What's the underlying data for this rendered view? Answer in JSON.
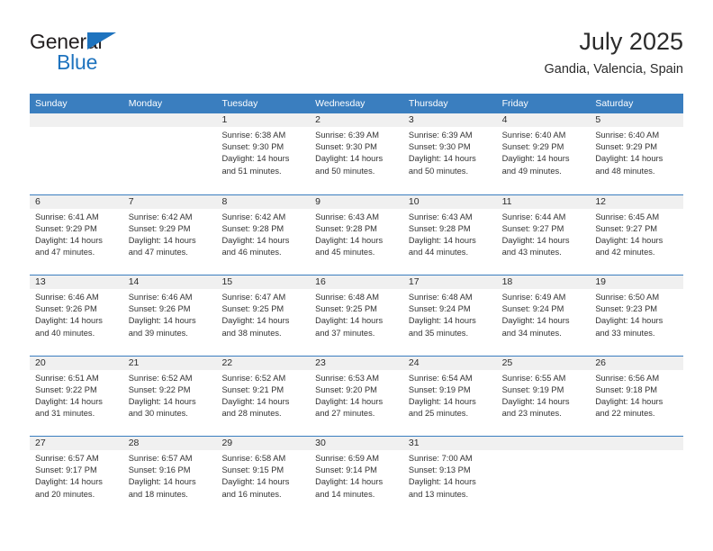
{
  "brand": {
    "line1": "General",
    "line2": "Blue",
    "triangle_color": "#1e73be",
    "text_color": "#231f20"
  },
  "header": {
    "title": "July 2025",
    "subtitle": "Gandia, Valencia, Spain"
  },
  "theme": {
    "header_blue": "#3a7ebf",
    "daynum_band": "#f0f0f0",
    "text": "#333333"
  },
  "weekdays": [
    "Sunday",
    "Monday",
    "Tuesday",
    "Wednesday",
    "Thursday",
    "Friday",
    "Saturday"
  ],
  "weeks": [
    [
      {
        "day": "",
        "sunrise": "",
        "sunset": "",
        "daylight1": "",
        "daylight2": ""
      },
      {
        "day": "",
        "sunrise": "",
        "sunset": "",
        "daylight1": "",
        "daylight2": ""
      },
      {
        "day": "1",
        "sunrise": "Sunrise: 6:38 AM",
        "sunset": "Sunset: 9:30 PM",
        "daylight1": "Daylight: 14 hours",
        "daylight2": "and 51 minutes."
      },
      {
        "day": "2",
        "sunrise": "Sunrise: 6:39 AM",
        "sunset": "Sunset: 9:30 PM",
        "daylight1": "Daylight: 14 hours",
        "daylight2": "and 50 minutes."
      },
      {
        "day": "3",
        "sunrise": "Sunrise: 6:39 AM",
        "sunset": "Sunset: 9:30 PM",
        "daylight1": "Daylight: 14 hours",
        "daylight2": "and 50 minutes."
      },
      {
        "day": "4",
        "sunrise": "Sunrise: 6:40 AM",
        "sunset": "Sunset: 9:29 PM",
        "daylight1": "Daylight: 14 hours",
        "daylight2": "and 49 minutes."
      },
      {
        "day": "5",
        "sunrise": "Sunrise: 6:40 AM",
        "sunset": "Sunset: 9:29 PM",
        "daylight1": "Daylight: 14 hours",
        "daylight2": "and 48 minutes."
      }
    ],
    [
      {
        "day": "6",
        "sunrise": "Sunrise: 6:41 AM",
        "sunset": "Sunset: 9:29 PM",
        "daylight1": "Daylight: 14 hours",
        "daylight2": "and 47 minutes."
      },
      {
        "day": "7",
        "sunrise": "Sunrise: 6:42 AM",
        "sunset": "Sunset: 9:29 PM",
        "daylight1": "Daylight: 14 hours",
        "daylight2": "and 47 minutes."
      },
      {
        "day": "8",
        "sunrise": "Sunrise: 6:42 AM",
        "sunset": "Sunset: 9:28 PM",
        "daylight1": "Daylight: 14 hours",
        "daylight2": "and 46 minutes."
      },
      {
        "day": "9",
        "sunrise": "Sunrise: 6:43 AM",
        "sunset": "Sunset: 9:28 PM",
        "daylight1": "Daylight: 14 hours",
        "daylight2": "and 45 minutes."
      },
      {
        "day": "10",
        "sunrise": "Sunrise: 6:43 AM",
        "sunset": "Sunset: 9:28 PM",
        "daylight1": "Daylight: 14 hours",
        "daylight2": "and 44 minutes."
      },
      {
        "day": "11",
        "sunrise": "Sunrise: 6:44 AM",
        "sunset": "Sunset: 9:27 PM",
        "daylight1": "Daylight: 14 hours",
        "daylight2": "and 43 minutes."
      },
      {
        "day": "12",
        "sunrise": "Sunrise: 6:45 AM",
        "sunset": "Sunset: 9:27 PM",
        "daylight1": "Daylight: 14 hours",
        "daylight2": "and 42 minutes."
      }
    ],
    [
      {
        "day": "13",
        "sunrise": "Sunrise: 6:46 AM",
        "sunset": "Sunset: 9:26 PM",
        "daylight1": "Daylight: 14 hours",
        "daylight2": "and 40 minutes."
      },
      {
        "day": "14",
        "sunrise": "Sunrise: 6:46 AM",
        "sunset": "Sunset: 9:26 PM",
        "daylight1": "Daylight: 14 hours",
        "daylight2": "and 39 minutes."
      },
      {
        "day": "15",
        "sunrise": "Sunrise: 6:47 AM",
        "sunset": "Sunset: 9:25 PM",
        "daylight1": "Daylight: 14 hours",
        "daylight2": "and 38 minutes."
      },
      {
        "day": "16",
        "sunrise": "Sunrise: 6:48 AM",
        "sunset": "Sunset: 9:25 PM",
        "daylight1": "Daylight: 14 hours",
        "daylight2": "and 37 minutes."
      },
      {
        "day": "17",
        "sunrise": "Sunrise: 6:48 AM",
        "sunset": "Sunset: 9:24 PM",
        "daylight1": "Daylight: 14 hours",
        "daylight2": "and 35 minutes."
      },
      {
        "day": "18",
        "sunrise": "Sunrise: 6:49 AM",
        "sunset": "Sunset: 9:24 PM",
        "daylight1": "Daylight: 14 hours",
        "daylight2": "and 34 minutes."
      },
      {
        "day": "19",
        "sunrise": "Sunrise: 6:50 AM",
        "sunset": "Sunset: 9:23 PM",
        "daylight1": "Daylight: 14 hours",
        "daylight2": "and 33 minutes."
      }
    ],
    [
      {
        "day": "20",
        "sunrise": "Sunrise: 6:51 AM",
        "sunset": "Sunset: 9:22 PM",
        "daylight1": "Daylight: 14 hours",
        "daylight2": "and 31 minutes."
      },
      {
        "day": "21",
        "sunrise": "Sunrise: 6:52 AM",
        "sunset": "Sunset: 9:22 PM",
        "daylight1": "Daylight: 14 hours",
        "daylight2": "and 30 minutes."
      },
      {
        "day": "22",
        "sunrise": "Sunrise: 6:52 AM",
        "sunset": "Sunset: 9:21 PM",
        "daylight1": "Daylight: 14 hours",
        "daylight2": "and 28 minutes."
      },
      {
        "day": "23",
        "sunrise": "Sunrise: 6:53 AM",
        "sunset": "Sunset: 9:20 PM",
        "daylight1": "Daylight: 14 hours",
        "daylight2": "and 27 minutes."
      },
      {
        "day": "24",
        "sunrise": "Sunrise: 6:54 AM",
        "sunset": "Sunset: 9:19 PM",
        "daylight1": "Daylight: 14 hours",
        "daylight2": "and 25 minutes."
      },
      {
        "day": "25",
        "sunrise": "Sunrise: 6:55 AM",
        "sunset": "Sunset: 9:19 PM",
        "daylight1": "Daylight: 14 hours",
        "daylight2": "and 23 minutes."
      },
      {
        "day": "26",
        "sunrise": "Sunrise: 6:56 AM",
        "sunset": "Sunset: 9:18 PM",
        "daylight1": "Daylight: 14 hours",
        "daylight2": "and 22 minutes."
      }
    ],
    [
      {
        "day": "27",
        "sunrise": "Sunrise: 6:57 AM",
        "sunset": "Sunset: 9:17 PM",
        "daylight1": "Daylight: 14 hours",
        "daylight2": "and 20 minutes."
      },
      {
        "day": "28",
        "sunrise": "Sunrise: 6:57 AM",
        "sunset": "Sunset: 9:16 PM",
        "daylight1": "Daylight: 14 hours",
        "daylight2": "and 18 minutes."
      },
      {
        "day": "29",
        "sunrise": "Sunrise: 6:58 AM",
        "sunset": "Sunset: 9:15 PM",
        "daylight1": "Daylight: 14 hours",
        "daylight2": "and 16 minutes."
      },
      {
        "day": "30",
        "sunrise": "Sunrise: 6:59 AM",
        "sunset": "Sunset: 9:14 PM",
        "daylight1": "Daylight: 14 hours",
        "daylight2": "and 14 minutes."
      },
      {
        "day": "31",
        "sunrise": "Sunrise: 7:00 AM",
        "sunset": "Sunset: 9:13 PM",
        "daylight1": "Daylight: 14 hours",
        "daylight2": "and 13 minutes."
      },
      {
        "day": "",
        "sunrise": "",
        "sunset": "",
        "daylight1": "",
        "daylight2": ""
      },
      {
        "day": "",
        "sunrise": "",
        "sunset": "",
        "daylight1": "",
        "daylight2": ""
      }
    ]
  ]
}
